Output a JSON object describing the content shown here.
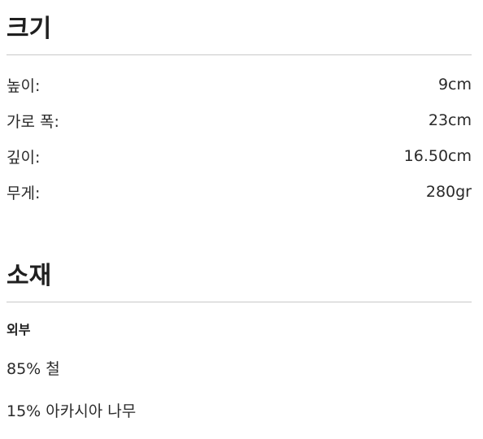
{
  "size_section": {
    "title": "크기",
    "rows": [
      {
        "label": "높이:",
        "value": "9cm"
      },
      {
        "label": "가로 폭:",
        "value": "23cm"
      },
      {
        "label": "깊이:",
        "value": "16.50cm"
      },
      {
        "label": "무게:",
        "value": "280gr"
      }
    ]
  },
  "material_section": {
    "title": "소재",
    "subheading": "외부",
    "lines": [
      "85% 철",
      "15% 아카시아 나무"
    ]
  }
}
